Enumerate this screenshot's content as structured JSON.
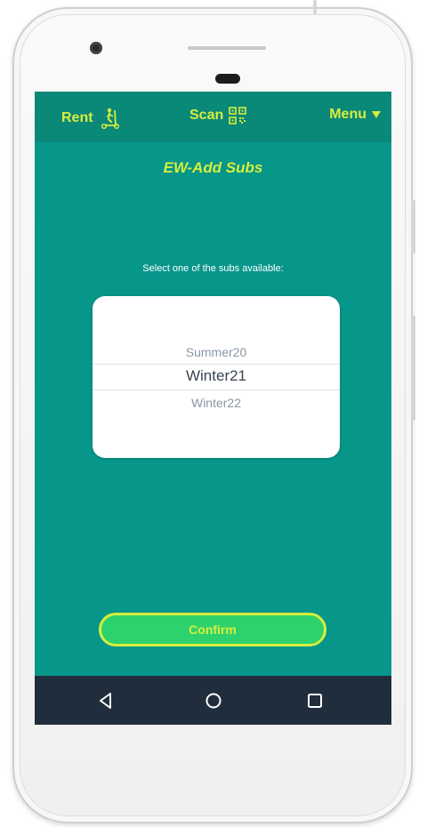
{
  "topbar": {
    "rent_label": "Rent",
    "scan_label": "Scan",
    "menu_label": "Menu",
    "rent_icon": "scooter-icon",
    "scan_icon": "qr-code-icon",
    "menu_icon": "caret-down-icon"
  },
  "page": {
    "title": "EW-Add Subs",
    "prompt": "Select one of the  subs available:"
  },
  "picker": {
    "options": [
      "Summer20",
      "Winter21",
      "Winter22"
    ],
    "selected": "Winter21"
  },
  "actions": {
    "confirm_label": "Confirm"
  },
  "system_nav": {
    "icons": [
      "back-icon",
      "home-icon",
      "recents-icon"
    ]
  },
  "colors": {
    "background": "#07968a",
    "topbar": "#0a8878",
    "accent": "#d6ee3c",
    "button": "#2dd26d",
    "system_nav": "#202d3d"
  }
}
